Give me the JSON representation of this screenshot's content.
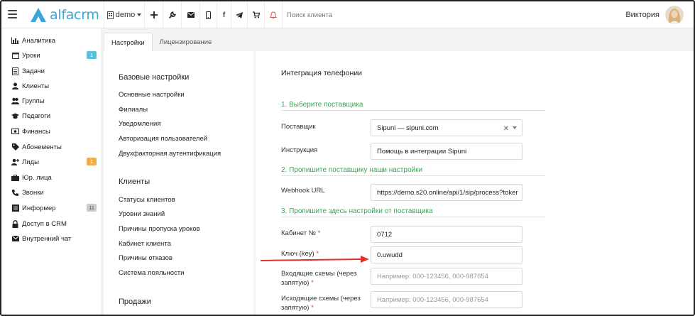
{
  "app": {
    "logo_text": "alfacrm",
    "brand_color": "#3ba7d9"
  },
  "topbar": {
    "branch_label": "demo",
    "icons": [
      "building-icon",
      "chevron-down-icon",
      "plus-icon",
      "wrench-icon",
      "mail-icon",
      "phone-icon",
      "facebook-icon",
      "telegram-icon",
      "cart-icon",
      "bell-icon"
    ],
    "search_placeholder": "Поиск клиента",
    "user_name": "Виктория"
  },
  "sidebar": {
    "items": [
      {
        "label": "Аналитика",
        "icon": "chart-icon"
      },
      {
        "label": "Уроки",
        "icon": "calendar-icon",
        "badge": "1",
        "badge_color": "#5bc0de"
      },
      {
        "label": "Задачи",
        "icon": "tasks-icon"
      },
      {
        "label": "Клиенты",
        "icon": "user-icon"
      },
      {
        "label": "Группы",
        "icon": "users-icon"
      },
      {
        "label": "Педагоги",
        "icon": "graduation-cap-icon"
      },
      {
        "label": "Финансы",
        "icon": "money-icon"
      },
      {
        "label": "Абонементы",
        "icon": "tag-icon"
      },
      {
        "label": "Лиды",
        "icon": "user-plus-icon",
        "badge": "1",
        "badge_color": "#f0ad4e"
      },
      {
        "label": "Юр. лица",
        "icon": "briefcase-icon"
      },
      {
        "label": "Звонки",
        "icon": "phone-icon"
      },
      {
        "label": "Информер",
        "icon": "list-icon",
        "badge": "11",
        "badge_color": "#c8ccd0"
      },
      {
        "label": "Доступ в CRM",
        "icon": "lock-icon"
      },
      {
        "label": "Внутренний чат",
        "icon": "envelope-icon"
      }
    ]
  },
  "tabs": [
    {
      "label": "Настройки",
      "active": true
    },
    {
      "label": "Лицензирование",
      "active": false
    }
  ],
  "settings_nav": {
    "basic_title": "Базовые настройки",
    "basic_links": [
      "Основные настройки",
      "Филиалы",
      "Уведомления",
      "Авторизация пользователей",
      "Двухфакторная аутентификация"
    ],
    "clients_title": "Клиенты",
    "clients_links": [
      "Статусы клиентов",
      "Уровни знаний",
      "Причины пропуска уроков",
      "Кабинет клиента",
      "Причины отказов",
      "Система лояльности"
    ],
    "sales_title": "Продажи"
  },
  "telephony": {
    "title": "Интеграция телефонии",
    "step1": "1. Выберите поставщика",
    "provider_label": "Поставщик",
    "provider_value": "Sipuni — sipuni.com",
    "instruction_label": "Инструкция",
    "instruction_value": "Помощь в интеграции Sipuni",
    "step2": "2. Пропишите поставщику наши настройки",
    "webhook_label": "Webhook URL",
    "webhook_value": "https://demo.s20.online/api/1/sip/process?toker",
    "step3": "3. Пропишите здесь настройки от поставщика",
    "cabinet_label": "Кабинет №",
    "cabinet_value": "0712",
    "key_label": "Ключ (key)",
    "key_value": "0.uwudd",
    "incoming_label_1": "Входящие схемы (через",
    "incoming_label_2": "запятую)",
    "incoming_placeholder": "Например: 000-123456, 000-987654",
    "outgoing_label_1": "Исходящие схемы (через",
    "outgoing_label_2": "запятую)",
    "outgoing_placeholder": "Например: 000-123456, 000-987654",
    "required_mark": "*",
    "accent_green": "#3aa655",
    "arrow_color": "#e03030"
  }
}
